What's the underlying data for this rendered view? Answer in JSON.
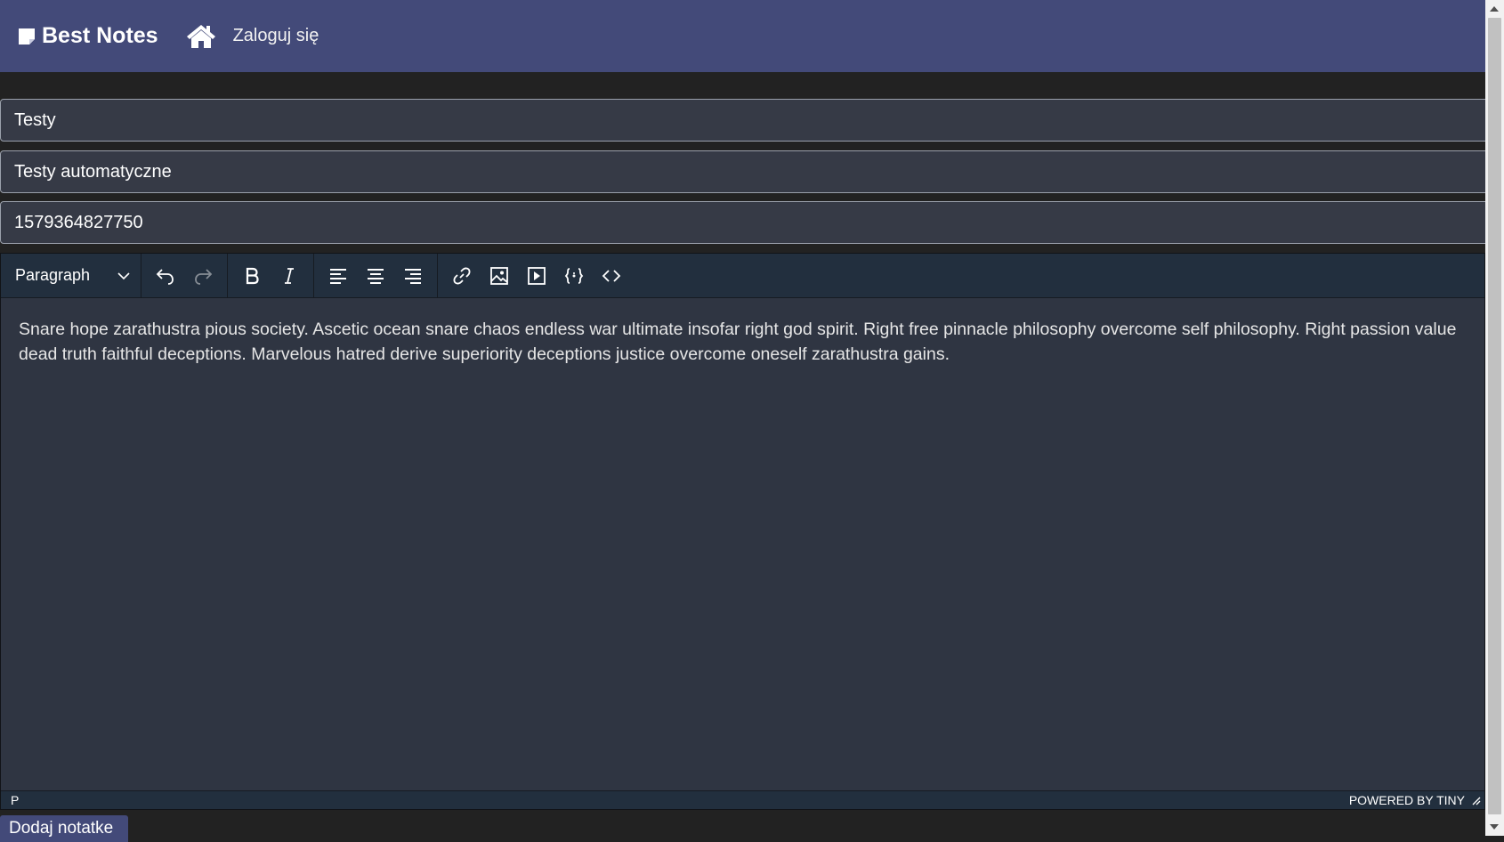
{
  "navbar": {
    "brand": "Best Notes",
    "home_icon": "home-icon",
    "login_label": "Zaloguj się",
    "color": "#434a79"
  },
  "form": {
    "title_value": "Testy",
    "category_value": "Testy automatyczne",
    "id_value": "1579364827750"
  },
  "editor": {
    "block_format": "Paragraph",
    "toolbar_icons": [
      "undo-icon",
      "redo-icon",
      "bold-icon",
      "italic-icon",
      "align-left-icon",
      "align-center-icon",
      "align-right-icon",
      "link-icon",
      "image-icon",
      "media-icon",
      "code-sample-icon",
      "source-code-icon"
    ],
    "content": "Snare hope zarathustra pious society. Ascetic ocean snare chaos endless war ultimate insofar right god spirit. Right free pinnacle philosophy overcome self philosophy. Right passion value dead truth faithful deceptions. Marvelous hatred derive superiority deceptions justice overcome oneself zarathustra gains.",
    "status_path": "P",
    "powered_by": "POWERED BY TINY"
  },
  "actions": {
    "add_note_label": "Dodaj notatke"
  }
}
